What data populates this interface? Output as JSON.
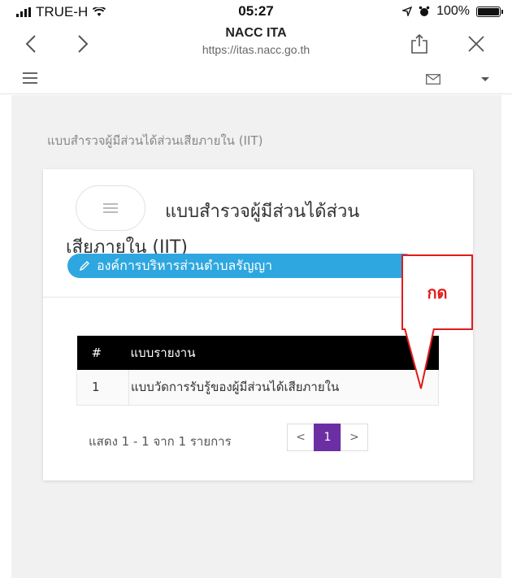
{
  "status_bar": {
    "carrier": "TRUE-H",
    "time": "05:27",
    "battery": "100%"
  },
  "browser": {
    "title": "NACC ITA",
    "url": "https://itas.nacc.go.th"
  },
  "breadcrumb": "แบบสำรวจผู้มีส่วนได้ส่วนเสียภายใน (IIT)",
  "card": {
    "title_line1": "แบบสำรวจผู้มีส่วนได้ส่วน",
    "title_line2": "เสียภายใน (IIT)",
    "organization": "องค์การบริหารส่วนตำบลรัญญา"
  },
  "table": {
    "headers": [
      "#",
      "แบบรายงาน"
    ],
    "rows": [
      {
        "num": "1",
        "name": "แบบวัดการรับรู้ของผู้มีส่วนได้เสียภายใน"
      }
    ]
  },
  "pagination": {
    "info": "แสดง 1 - 1 จาก 1 รายการ",
    "prev": "<",
    "current": "1",
    "next": ">"
  },
  "callout": {
    "text": "กด",
    "color": "#e21b1b"
  },
  "colors": {
    "pill": "#2ea7e0",
    "page_active": "#6b2fa3",
    "table_header": "#000000"
  }
}
